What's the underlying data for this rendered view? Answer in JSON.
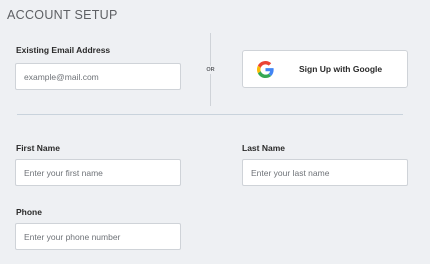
{
  "header": {
    "title": "ACCOUNT SETUP"
  },
  "existing_email": {
    "label": "Existing Email Address",
    "placeholder": "example@mail.com",
    "value": ""
  },
  "separator": {
    "or_label": "OR"
  },
  "google": {
    "label": "Sign Up with Google",
    "colors": {
      "blue": "#4285F4",
      "red": "#EA4335",
      "yellow": "#FBBC05",
      "green": "#34A853"
    }
  },
  "first_name": {
    "label": "First Name",
    "placeholder": "Enter your first name",
    "value": ""
  },
  "last_name": {
    "label": "Last Name",
    "placeholder": "Enter your last name",
    "value": ""
  },
  "phone": {
    "label": "Phone",
    "placeholder": "Enter your phone number",
    "value": ""
  },
  "theme": {
    "background": "#eef0f3",
    "border": "#cfd3d8",
    "title_color": "#5e6064"
  }
}
